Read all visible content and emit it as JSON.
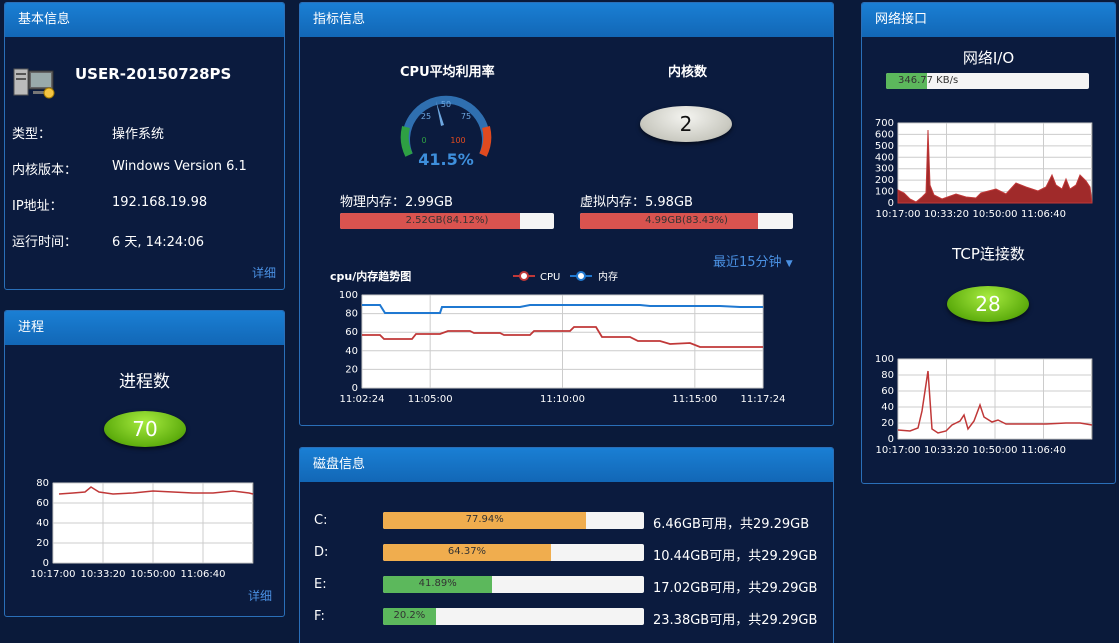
{
  "basic": {
    "title": "基本信息",
    "hostname": "USER-20150728PS",
    "rows": [
      {
        "label": "类型：",
        "value": "操作系统"
      },
      {
        "label": "内核版本：",
        "value": "Windows Version 6.1"
      },
      {
        "label": "IP地址：",
        "value": "192.168.19.98"
      },
      {
        "label": "运行时间：",
        "value": "6 天, 14:24:06"
      }
    ],
    "detail": "详细"
  },
  "process": {
    "title": "进程",
    "count_label": "进程数",
    "count": "70",
    "detail": "详细",
    "chart": {
      "yticks": [
        "80",
        "60",
        "40",
        "20",
        "0"
      ],
      "xticks": [
        "10:17:00",
        "10:33:20",
        "10:50:00",
        "11:06:40"
      ]
    }
  },
  "metrics": {
    "title": "指标信息",
    "cpu_label": "CPU平均利用率",
    "cpu_value": "41.5%",
    "gauge_ticks": [
      "0",
      "25",
      "50",
      "75",
      "100"
    ],
    "core_label": "内核数",
    "core_count": "2",
    "phys_mem": "物理内存：2.99GB",
    "phys_bar": "2.52GB(84.12%)",
    "phys_pct": 84.12,
    "virt_mem": "虚拟内存：5.98GB",
    "virt_bar": "4.99GB(83.43%)",
    "virt_pct": 83.43,
    "range_select": "最近15分钟",
    "trend_title": "cpu/内存趋势图",
    "legend": [
      "CPU",
      "内存"
    ],
    "trend_yticks": [
      "100",
      "80",
      "60",
      "40",
      "20",
      "0"
    ],
    "trend_xticks": [
      "11:02:24",
      "11:05:00",
      "11:10:00",
      "11:15:00",
      "11:17:24"
    ]
  },
  "network": {
    "title": "网络接口",
    "io_label": "网络I/O",
    "io_bar": "346.77 KB/s",
    "io_pct": 20,
    "io_yticks": [
      "700",
      "600",
      "500",
      "400",
      "300",
      "200",
      "100",
      "0"
    ],
    "xticks": [
      "10:17:00",
      "10:33:20",
      "10:50:00",
      "11:06:40"
    ],
    "tcp_label": "TCP连接数",
    "tcp_count": "28",
    "tcp_yticks": [
      "100",
      "80",
      "60",
      "40",
      "20",
      "0"
    ]
  },
  "disk": {
    "title": "磁盘信息",
    "drives": [
      {
        "name": "C:",
        "pct_text": "77.94%",
        "pct": 77.94,
        "info": "6.46GB可用，共29.29GB",
        "color": "#f0ad4e"
      },
      {
        "name": "D:",
        "pct_text": "64.37%",
        "pct": 64.37,
        "info": "10.44GB可用，共29.29GB",
        "color": "#f0ad4e"
      },
      {
        "name": "E:",
        "pct_text": "41.89%",
        "pct": 41.89,
        "info": "17.02GB可用，共29.29GB",
        "color": "#5cb85c"
      },
      {
        "name": "F:",
        "pct_text": "20.2%",
        "pct": 20.2,
        "info": "23.38GB可用，共29.29GB",
        "color": "#5cb85c"
      }
    ]
  },
  "colors": {
    "cpu": "#b03030",
    "mem": "#1f78d1",
    "accent": "#1a7fd4"
  }
}
